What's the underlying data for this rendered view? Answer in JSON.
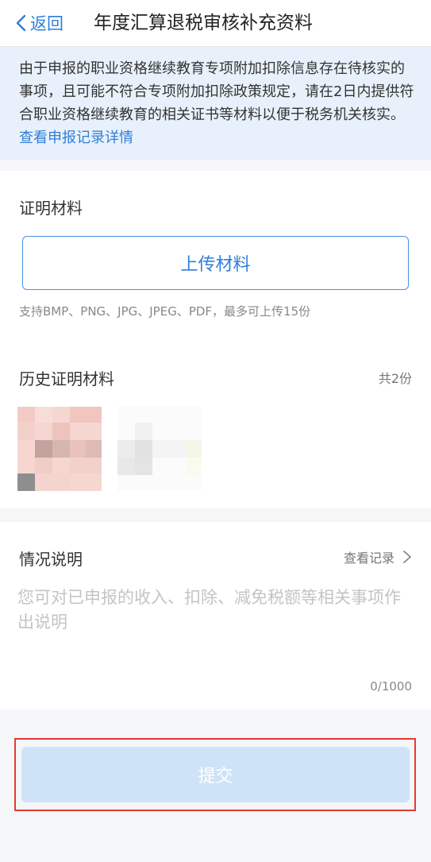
{
  "header": {
    "back_label": "返回",
    "title": "年度汇算退税审核补充资料"
  },
  "notice": {
    "text": "由于申报的职业资格继续教育专项附加扣除信息存在待核实的事项，且可能不符合专项附加扣除政策规定，请在2日内提供符合职业资格继续教育的相关证书等材料以便于税务机关核实。",
    "link_label": "查看申报记录详情"
  },
  "proof": {
    "title": "证明材料",
    "upload_label": "上传材料",
    "hint": "支持BMP、PNG、JPG、JPEG、PDF，最多可上传15份"
  },
  "history": {
    "title": "历史证明材料",
    "count_label": "共2份"
  },
  "explanation": {
    "title": "情况说明",
    "view_record_label": "查看记录",
    "placeholder": "您可对已申报的收入、扣除、减免税额等相关事项作出说明",
    "counter": "0/1000"
  },
  "submit": {
    "label": "提交"
  },
  "colors": {
    "accent": "#2f7fd8",
    "notice_bg": "#e8f1fb",
    "submit_disabled_bg": "#cfe3f8",
    "highlight_border": "#e53935"
  }
}
